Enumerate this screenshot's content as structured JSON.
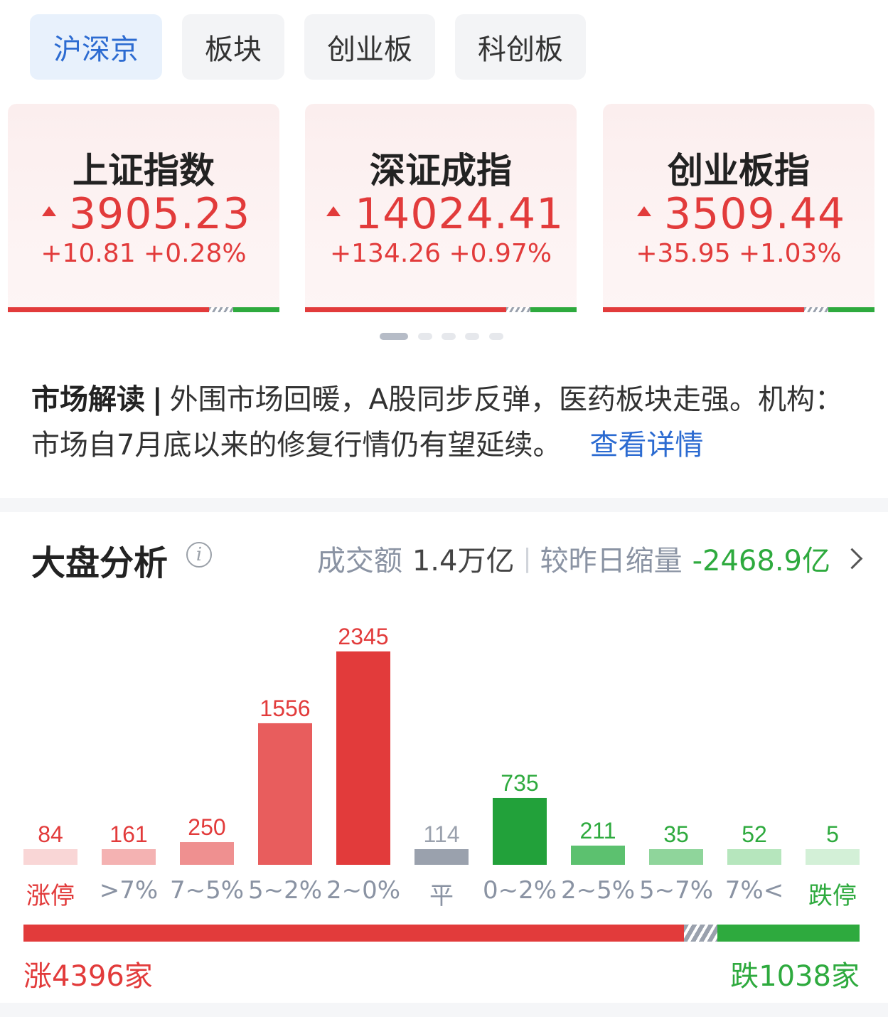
{
  "tabs": [
    {
      "label": "沪深京",
      "active": true
    },
    {
      "label": "板块",
      "active": false
    },
    {
      "label": "创业板",
      "active": false
    },
    {
      "label": "科创板",
      "active": false
    }
  ],
  "indices": [
    {
      "name": "上证指数",
      "price": "3905.23",
      "change": "+10.81 +0.28%"
    },
    {
      "name": "深证成指",
      "price": "14024.41",
      "change": "+134.26 +0.97%"
    },
    {
      "name": "创业板指",
      "price": "3509.44",
      "change": "+35.95 +1.03%"
    }
  ],
  "pager": {
    "count": 5,
    "active_index": 0
  },
  "commentary": {
    "label": "市场解读",
    "separator": "|",
    "text": "外围市场回暖，A股同步反弹，医药板块走强。机构：市场自7月底以来的修复行情仍有望延续。",
    "link": "查看详情"
  },
  "analysis": {
    "title": "大盘分析",
    "info_icon": "i",
    "turnover_label": "成交额",
    "turnover_value": "1.4万亿",
    "compare_label": "较昨日缩量",
    "compare_value": "-2468.9亿"
  },
  "colors": {
    "up": "#e23b3b",
    "down": "#2eaa3e",
    "flat": "#9aa1ad",
    "link": "#2c6bd1"
  },
  "chart_data": {
    "type": "bar",
    "categories": [
      "涨停",
      ">7%",
      "7~5%",
      "5~2%",
      "2~0%",
      "平",
      "0~2%",
      "2~5%",
      "5~7%",
      "7%<",
      "跌停"
    ],
    "values": [
      84,
      161,
      250,
      1556,
      2345,
      114,
      735,
      211,
      35,
      52,
      5
    ],
    "bar_colors": [
      "#f9d6d6",
      "#f4b2b2",
      "#ef9090",
      "#e85d5d",
      "#e23b3b",
      "#9aa1ad",
      "#22a13a",
      "#5cc16f",
      "#8fd59b",
      "#b6e6bd",
      "#d3f0d7"
    ],
    "label_colors": [
      "#e23b3b",
      "#e23b3b",
      "#e23b3b",
      "#e23b3b",
      "#e23b3b",
      "#9aa1ad",
      "#2eaa3e",
      "#2eaa3e",
      "#2eaa3e",
      "#2eaa3e",
      "#2eaa3e"
    ],
    "category_label_colors": [
      "#e23b3b",
      "#8a93a3",
      "#8a93a3",
      "#8a93a3",
      "#8a93a3",
      "#8a93a3",
      "#8a93a3",
      "#8a93a3",
      "#8a93a3",
      "#8a93a3",
      "#2eaa3e"
    ]
  },
  "summary": {
    "up_text": "涨4396家",
    "down_text": "跌1038家"
  }
}
